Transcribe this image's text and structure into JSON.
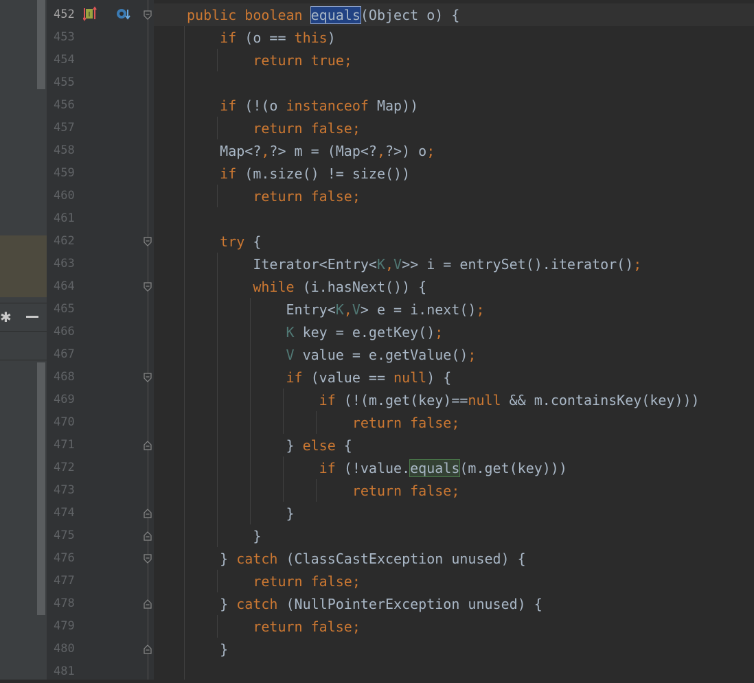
{
  "gutter": {
    "line_numbers": [
      "452",
      "453",
      "454",
      "455",
      "456",
      "457",
      "458",
      "459",
      "460",
      "461",
      "462",
      "463",
      "464",
      "465",
      "466",
      "467",
      "468",
      "469",
      "470",
      "471",
      "472",
      "473",
      "474",
      "475",
      "476",
      "477",
      "478",
      "479",
      "480",
      "481"
    ]
  },
  "left_panel": {
    "gear_glyph": "✱"
  },
  "code_lines": [
    [
      [
        "public boolean ",
        "kw"
      ],
      [
        "equals",
        "sel"
      ],
      [
        "(Object o) {",
        ""
      ]
    ],
    [
      [
        "    ",
        ""
      ],
      [
        "if ",
        "kw"
      ],
      [
        "(o == ",
        ""
      ],
      [
        "this",
        "kw"
      ],
      [
        ")",
        ""
      ]
    ],
    [
      [
        "        ",
        ""
      ],
      [
        "return true;",
        "kw"
      ]
    ],
    [],
    [
      [
        "    ",
        ""
      ],
      [
        "if ",
        "kw"
      ],
      [
        "(!(o ",
        ""
      ],
      [
        "instanceof ",
        "kw"
      ],
      [
        "Map))",
        ""
      ]
    ],
    [
      [
        "        ",
        ""
      ],
      [
        "return false;",
        "kw"
      ]
    ],
    [
      [
        "    Map<?",
        ""
      ],
      [
        ",",
        "kw"
      ],
      [
        "?> m = (Map<?",
        ""
      ],
      [
        ",",
        "kw"
      ],
      [
        "?>) o",
        ""
      ],
      [
        ";",
        "kw"
      ]
    ],
    [
      [
        "    ",
        ""
      ],
      [
        "if ",
        "kw"
      ],
      [
        "(m.size() != size())",
        ""
      ]
    ],
    [
      [
        "        ",
        ""
      ],
      [
        "return false;",
        "kw"
      ]
    ],
    [],
    [
      [
        "    ",
        ""
      ],
      [
        "try ",
        "kw"
      ],
      [
        "{",
        ""
      ]
    ],
    [
      [
        "        Iterator<Entry<",
        ""
      ],
      [
        "K",
        "tp"
      ],
      [
        ",",
        "kw"
      ],
      [
        "V",
        "tp"
      ],
      [
        ">> i = entrySet().iterator()",
        ""
      ],
      [
        ";",
        "kw"
      ]
    ],
    [
      [
        "        ",
        ""
      ],
      [
        "while ",
        "kw"
      ],
      [
        "(i.hasNext()) {",
        ""
      ]
    ],
    [
      [
        "            Entry<",
        ""
      ],
      [
        "K",
        "tp"
      ],
      [
        ",",
        "kw"
      ],
      [
        "V",
        "tp"
      ],
      [
        "> e = i.next()",
        ""
      ],
      [
        ";",
        "kw"
      ]
    ],
    [
      [
        "            ",
        ""
      ],
      [
        "K",
        "tp"
      ],
      [
        " key = e.getKey()",
        ""
      ],
      [
        ";",
        "kw"
      ]
    ],
    [
      [
        "            ",
        ""
      ],
      [
        "V",
        "tp"
      ],
      [
        " value = e.getValue()",
        ""
      ],
      [
        ";",
        "kw"
      ]
    ],
    [
      [
        "            ",
        ""
      ],
      [
        "if ",
        "kw"
      ],
      [
        "(value == ",
        ""
      ],
      [
        "null",
        "kw"
      ],
      [
        ") {",
        ""
      ]
    ],
    [
      [
        "                ",
        ""
      ],
      [
        "if ",
        "kw"
      ],
      [
        "(!(m.get(key)==",
        ""
      ],
      [
        "null ",
        "kw"
      ],
      [
        "&& m.containsKey(key)))",
        ""
      ]
    ],
    [
      [
        "                    ",
        ""
      ],
      [
        "return false;",
        "kw"
      ]
    ],
    [
      [
        "            } ",
        ""
      ],
      [
        "else ",
        "kw"
      ],
      [
        "{",
        ""
      ]
    ],
    [
      [
        "                ",
        ""
      ],
      [
        "if ",
        "kw"
      ],
      [
        "(!value.",
        ""
      ],
      [
        "equals",
        "hl"
      ],
      [
        "(m.get(key)))",
        ""
      ]
    ],
    [
      [
        "                    ",
        ""
      ],
      [
        "return false;",
        "kw"
      ]
    ],
    [
      [
        "            }",
        ""
      ]
    ],
    [
      [
        "        }",
        ""
      ]
    ],
    [
      [
        "    } ",
        ""
      ],
      [
        "catch ",
        "kw"
      ],
      [
        "(ClassCastException unused) {",
        ""
      ]
    ],
    [
      [
        "        ",
        ""
      ],
      [
        "return false;",
        "kw"
      ]
    ],
    [
      [
        "    } ",
        ""
      ],
      [
        "catch ",
        "kw"
      ],
      [
        "(NullPointerException unused) {",
        ""
      ]
    ],
    [
      [
        "        ",
        ""
      ],
      [
        "return false;",
        "kw"
      ]
    ],
    [
      [
        "    }",
        ""
      ]
    ],
    []
  ],
  "fold_markers": {
    "open": [
      0,
      10,
      12,
      16,
      24
    ],
    "close": [
      19,
      22,
      23,
      26,
      28
    ]
  },
  "colors": {
    "keyword": "#cc7832",
    "text": "#a9b7c6",
    "type_param": "#507874",
    "line_number": "#606366",
    "selection": "#214283",
    "usage_highlight": "#344134"
  }
}
